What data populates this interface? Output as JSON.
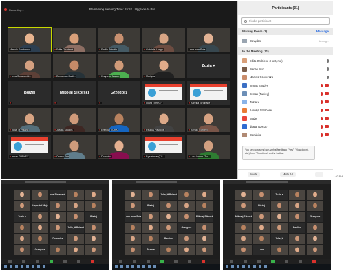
{
  "window": {
    "recording_label": "Recording...",
    "timer_text": "Remaining Meeting Time: 15:52 | Upgrade to Pro"
  },
  "gallery": {
    "tiles": [
      {
        "name": "Mariola Sandurska",
        "type": "video",
        "muted": false,
        "speaker": true,
        "face": "#e8b48f",
        "body": "#2c3e50"
      },
      {
        "name": "Edita Grubiené",
        "type": "video",
        "muted": true,
        "speaker": false,
        "face": "#d9a07a",
        "body": "#8d6e63"
      },
      {
        "name": "Emilio Petrolio",
        "type": "video",
        "muted": true,
        "speaker": false,
        "face": "#c89070",
        "body": "#455a64"
      },
      {
        "name": "Gabriele Lango",
        "type": "video",
        "muted": true,
        "speaker": false,
        "face": "#d8a585",
        "body": "#6d4c41"
      },
      {
        "name": "Lena from Pola",
        "type": "video",
        "muted": false,
        "speaker": false,
        "face": "#e2b294",
        "body": "#37474f"
      },
      {
        "name": "Ieva Simanaviči...",
        "type": "video",
        "muted": true,
        "speaker": false,
        "face": "#d4a080",
        "body": "#5d4037"
      },
      {
        "name": "Domantas Radi...",
        "type": "video",
        "muted": true,
        "speaker": false,
        "face": "#c58a68",
        "body": "#263238"
      },
      {
        "name": "Krzysztof Majcer",
        "type": "video",
        "muted": true,
        "speaker": false,
        "face": "#d09a78",
        "body": "#4caf50"
      },
      {
        "name": "Martyna",
        "type": "video",
        "muted": true,
        "speaker": false,
        "face": "#e0ab8a",
        "body": "#212121"
      },
      {
        "name": "Zuzia ♥",
        "type": "blank",
        "muted": false,
        "speaker": false,
        "face": "",
        "body": ""
      },
      {
        "name": "Błażej",
        "type": "blank",
        "muted": true,
        "speaker": false,
        "face": "",
        "body": ""
      },
      {
        "name": "Mikołaj Sikorski",
        "type": "blank",
        "muted": true,
        "speaker": false,
        "face": "",
        "body": ""
      },
      {
        "name": "Grzegorz",
        "type": "blank",
        "muted": true,
        "speaker": false,
        "face": "",
        "body": ""
      },
      {
        "name": "dilara TURKEY",
        "type": "slide",
        "muted": true,
        "speaker": false,
        "face": "",
        "body": ""
      },
      {
        "name": "Aurelija Strolbaite",
        "type": "slide",
        "muted": true,
        "speaker": false,
        "face": "",
        "body": ""
      },
      {
        "name": "Julia_H Poland",
        "type": "video",
        "muted": true,
        "speaker": false,
        "face": "#d8a483",
        "body": "#546e7a"
      },
      {
        "name": "Justas Spudys",
        "type": "video",
        "muted": true,
        "speaker": false,
        "face": "#cf9a7a",
        "body": "#3e2723"
      },
      {
        "name": "Eren Arı TURK",
        "type": "video",
        "muted": true,
        "speaker": false,
        "face": "#b8825f",
        "body": "#1565c0"
      },
      {
        "name": "Paulius Pavilonis",
        "type": "video",
        "muted": true,
        "speaker": false,
        "face": "#dca989",
        "body": "#424242"
      },
      {
        "name": "Berrak (Turkey)",
        "type": "video",
        "muted": true,
        "speaker": false,
        "face": "#d6a282",
        "body": "#795548"
      },
      {
        "name": "irmak TURKEY",
        "type": "slide",
        "muted": true,
        "speaker": false,
        "face": "",
        "body": ""
      },
      {
        "name": "Canan Sen",
        "type": "video",
        "muted": true,
        "speaker": false,
        "face": "#cf9c7c",
        "body": "#607d8b"
      },
      {
        "name": "Dominika",
        "type": "video",
        "muted": true,
        "speaker": false,
        "face": "#e4b090",
        "body": "#880e4f"
      },
      {
        "name": "Ege akman(TU...",
        "type": "slide",
        "muted": true,
        "speaker": false,
        "face": "",
        "body": ""
      },
      {
        "name": "Lara Ilınınz (Tur...",
        "type": "video",
        "muted": true,
        "speaker": false,
        "face": "#d2a080",
        "body": "#2e7d32"
      }
    ]
  },
  "participants": {
    "title": "Participants (31)",
    "search_placeholder": "Find a participant",
    "waiting_room_label": "Waiting Room (1)",
    "message_label": "Message",
    "waiting": [
      {
        "name": "Dovydas",
        "status": "Unmig...",
        "color": "#9aa5b1"
      }
    ],
    "in_meeting_label": "In the Meeting (31)",
    "list": [
      {
        "name": "Edita Grubiené (Host, me)",
        "color": "#d9a07a",
        "mic_off": false,
        "cam_off": false
      },
      {
        "name": "Canan Sen",
        "color": "#7a5d4a",
        "mic_off": false,
        "cam_off": false
      },
      {
        "name": "Mariola Sandurska",
        "color": "#c98c6b",
        "mic_off": false,
        "cam_off": false
      },
      {
        "name": "Justas Spudys",
        "color": "#3b6fc4",
        "mic_off": true,
        "cam_off": true
      },
      {
        "name": "Berrak (Turkey)",
        "color": "#6d8fb7",
        "mic_off": true,
        "cam_off": true
      },
      {
        "name": "Zuzia ♥",
        "color": "#8ab4e8",
        "mic_off": true,
        "cam_off": true
      },
      {
        "name": "Aurelija Strolbaite",
        "color": "#e97b35",
        "mic_off": true,
        "cam_off": true
      },
      {
        "name": "Błażej",
        "color": "#e9443a",
        "mic_off": true,
        "cam_off": true
      },
      {
        "name": "dilara TURKEY",
        "color": "#2f6bd1",
        "mic_off": true,
        "cam_off": true
      },
      {
        "name": "Dominika",
        "color": "#b08a74",
        "mic_off": true,
        "cam_off": true
      }
    ],
    "toast_text": "You can now send non-verbal feedback (\"yes\", \"slow down\", etc.) from \"Reactions\" on the toolbar.",
    "invite_label": "Invite",
    "mute_all_label": "Mute All",
    "more_label": "...",
    "clock": "1:40 PM"
  },
  "thumbnails": [
    {
      "labels": [
        "Ieva Simanavi...",
        "Krzysztof Majcer",
        "Zuzia ♥",
        "Błażej",
        "Julia_H Poland",
        "Dominika",
        "Grzegorz",
        "Paulius"
      ]
    },
    {
      "labels": [
        "Julia_H Poland",
        "Błażej",
        "Lena from Poland",
        "Mikołaj Sikorski",
        "Grzegorz",
        "Paulius",
        "Zuzia ♥",
        "Gabriele"
      ]
    },
    {
      "labels": [
        "Zuzia ♥",
        "Błażej",
        "Mikołaj Sikorski",
        "Grzegorz",
        "Paulius",
        "Julia_H",
        "Lena",
        "Dominika"
      ]
    }
  ]
}
